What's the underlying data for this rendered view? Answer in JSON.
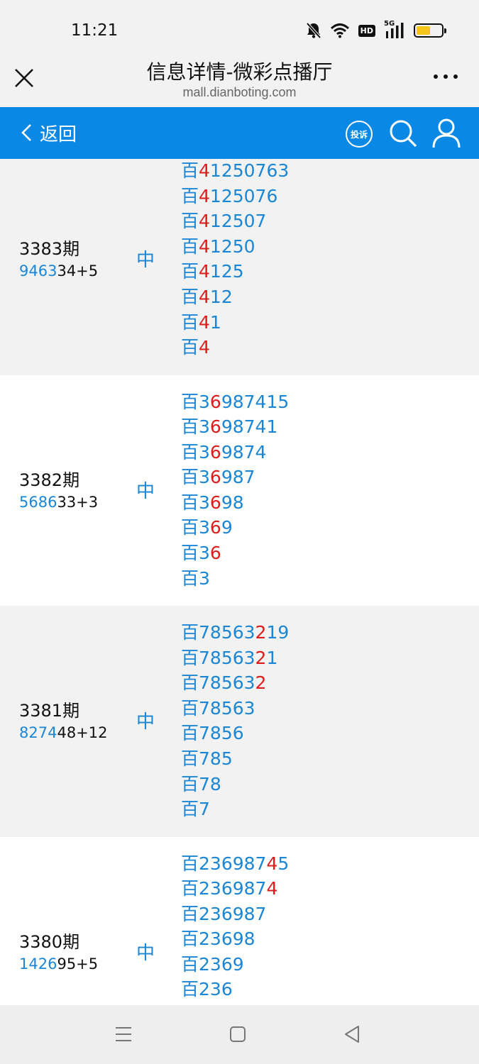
{
  "status": {
    "time": "11:21",
    "hd": "HD",
    "network": "5G",
    "battery_level": 0.55
  },
  "titlebar": {
    "title": "信息详情-微彩点播厅",
    "url": "mall.dianboting.com"
  },
  "nav": {
    "back_label": "返回",
    "complain_label": "投诉"
  },
  "colors": {
    "accent": "#0a88e6",
    "number_blue": "#1b86d6",
    "highlight_red": "#e01b1b"
  },
  "rows": [
    {
      "issue": "3383期",
      "result_blue": "9463",
      "result_rest": "34+5",
      "hit": "中",
      "lines": [
        {
          "prefix": "百",
          "pre": "",
          "red": "4",
          "post": "1250763"
        },
        {
          "prefix": "百",
          "pre": "",
          "red": "4",
          "post": "125076"
        },
        {
          "prefix": "百",
          "pre": "",
          "red": "4",
          "post": "12507"
        },
        {
          "prefix": "百",
          "pre": "",
          "red": "4",
          "post": "1250"
        },
        {
          "prefix": "百",
          "pre": "",
          "red": "4",
          "post": "125"
        },
        {
          "prefix": "百",
          "pre": "",
          "red": "4",
          "post": "12"
        },
        {
          "prefix": "百",
          "pre": "",
          "red": "4",
          "post": "1"
        },
        {
          "prefix": "百",
          "pre": "",
          "red": "4",
          "post": ""
        }
      ]
    },
    {
      "issue": "3382期",
      "result_blue": "5686",
      "result_rest": "33+3",
      "hit": "中",
      "lines": [
        {
          "prefix": "百",
          "pre": "3",
          "red": "6",
          "post": "987415"
        },
        {
          "prefix": "百",
          "pre": "3",
          "red": "6",
          "post": "98741"
        },
        {
          "prefix": "百",
          "pre": "3",
          "red": "6",
          "post": "9874"
        },
        {
          "prefix": "百",
          "pre": "3",
          "red": "6",
          "post": "987"
        },
        {
          "prefix": "百",
          "pre": "3",
          "red": "6",
          "post": "98"
        },
        {
          "prefix": "百",
          "pre": "3",
          "red": "6",
          "post": "9"
        },
        {
          "prefix": "百",
          "pre": "3",
          "red": "6",
          "post": ""
        },
        {
          "prefix": "百",
          "pre": "3",
          "red": "",
          "post": ""
        }
      ]
    },
    {
      "issue": "3381期",
      "result_blue": "8274",
      "result_rest": "48+12",
      "hit": "中",
      "lines": [
        {
          "prefix": "百",
          "pre": "78563",
          "red": "2",
          "post": "19"
        },
        {
          "prefix": "百",
          "pre": "78563",
          "red": "2",
          "post": "1"
        },
        {
          "prefix": "百",
          "pre": "78563",
          "red": "2",
          "post": ""
        },
        {
          "prefix": "百",
          "pre": "78563",
          "red": "",
          "post": ""
        },
        {
          "prefix": "百",
          "pre": "7856",
          "red": "",
          "post": ""
        },
        {
          "prefix": "百",
          "pre": "785",
          "red": "",
          "post": ""
        },
        {
          "prefix": "百",
          "pre": "78",
          "red": "",
          "post": ""
        },
        {
          "prefix": "百",
          "pre": "7",
          "red": "",
          "post": ""
        }
      ]
    },
    {
      "issue": "3380期",
      "result_blue": "1426",
      "result_rest": "95+5",
      "hit": "中",
      "lines": [
        {
          "prefix": "百",
          "pre": "236987",
          "red": "4",
          "post": "5"
        },
        {
          "prefix": "百",
          "pre": "236987",
          "red": "4",
          "post": ""
        },
        {
          "prefix": "百",
          "pre": "236987",
          "red": "",
          "post": ""
        },
        {
          "prefix": "百",
          "pre": "23698",
          "red": "",
          "post": ""
        },
        {
          "prefix": "百",
          "pre": "2369",
          "red": "",
          "post": ""
        },
        {
          "prefix": "百",
          "pre": "236",
          "red": "",
          "post": ""
        }
      ]
    }
  ]
}
